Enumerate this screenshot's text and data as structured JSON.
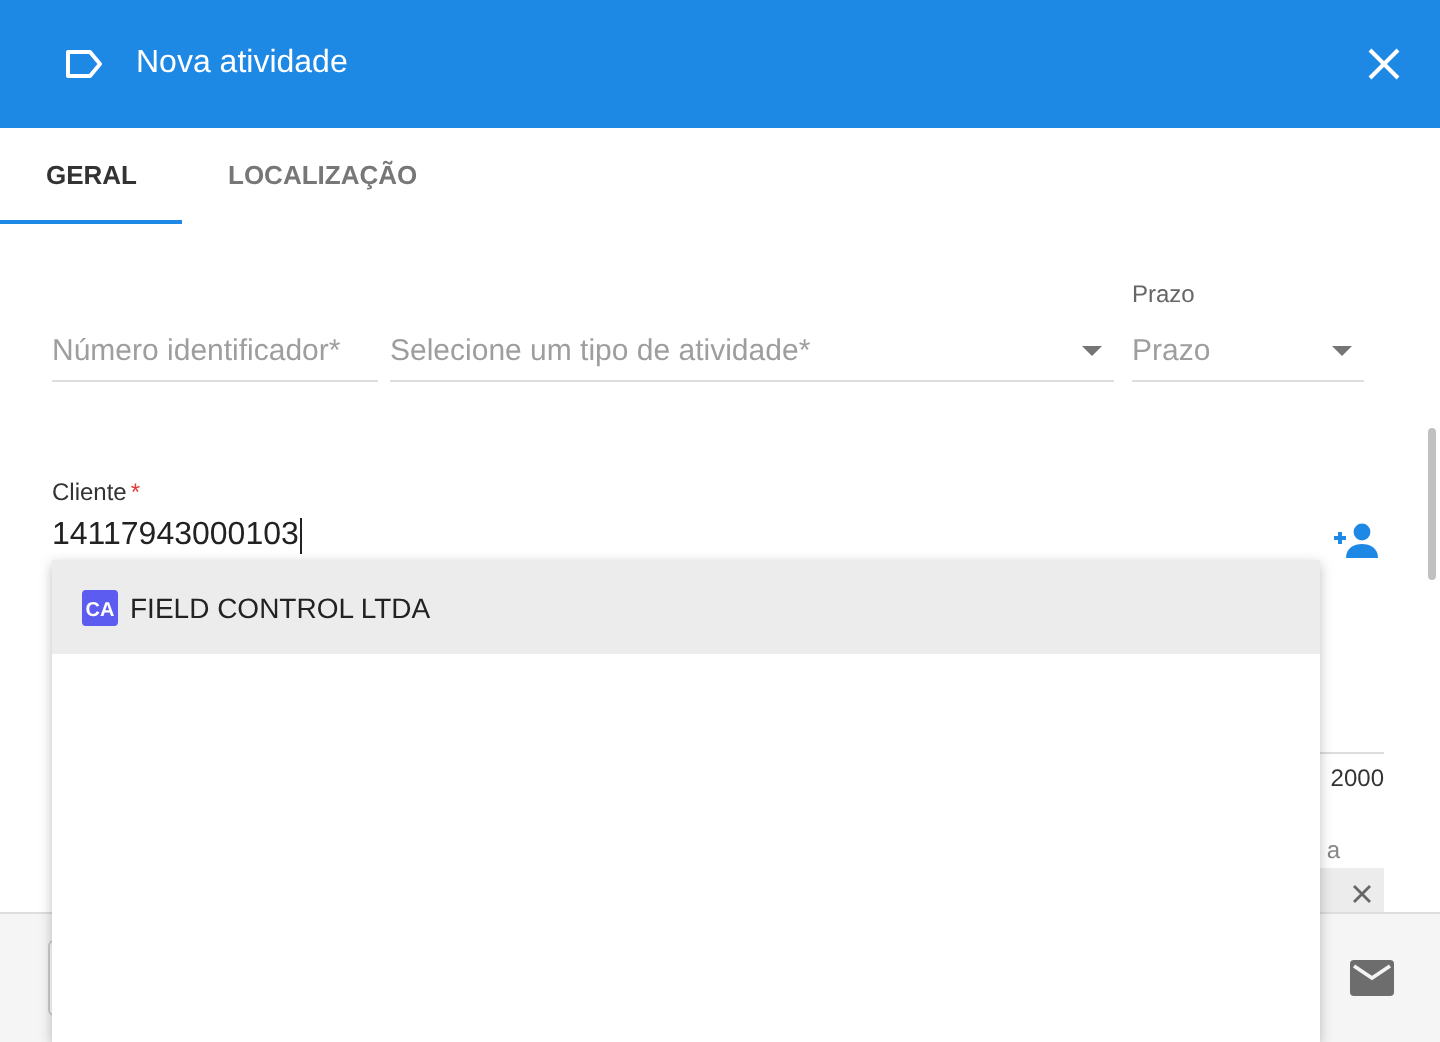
{
  "dialog": {
    "title": "Nova atividade"
  },
  "tabs": [
    {
      "label": "GERAL",
      "selected": true
    },
    {
      "label": "LOCALIZAÇÃO",
      "selected": false
    }
  ],
  "fields": [
    {
      "kind": "text",
      "placeholder": "Número identificador",
      "required_mark": "*"
    },
    {
      "kind": "select",
      "placeholder": "Selecione um tipo de atividade",
      "required_mark": "*"
    },
    {
      "kind": "select",
      "label": "Prazo",
      "placeholder": "Prazo"
    }
  ],
  "client": {
    "label": "Cliente",
    "required_mark": "*",
    "value": "14117943000103"
  },
  "suggestions": [
    {
      "badge": "CA",
      "name": "FIELD CONTROL LTDA",
      "selected": true
    }
  ],
  "hidden_behind": {
    "counter": "2000",
    "label": "a"
  }
}
